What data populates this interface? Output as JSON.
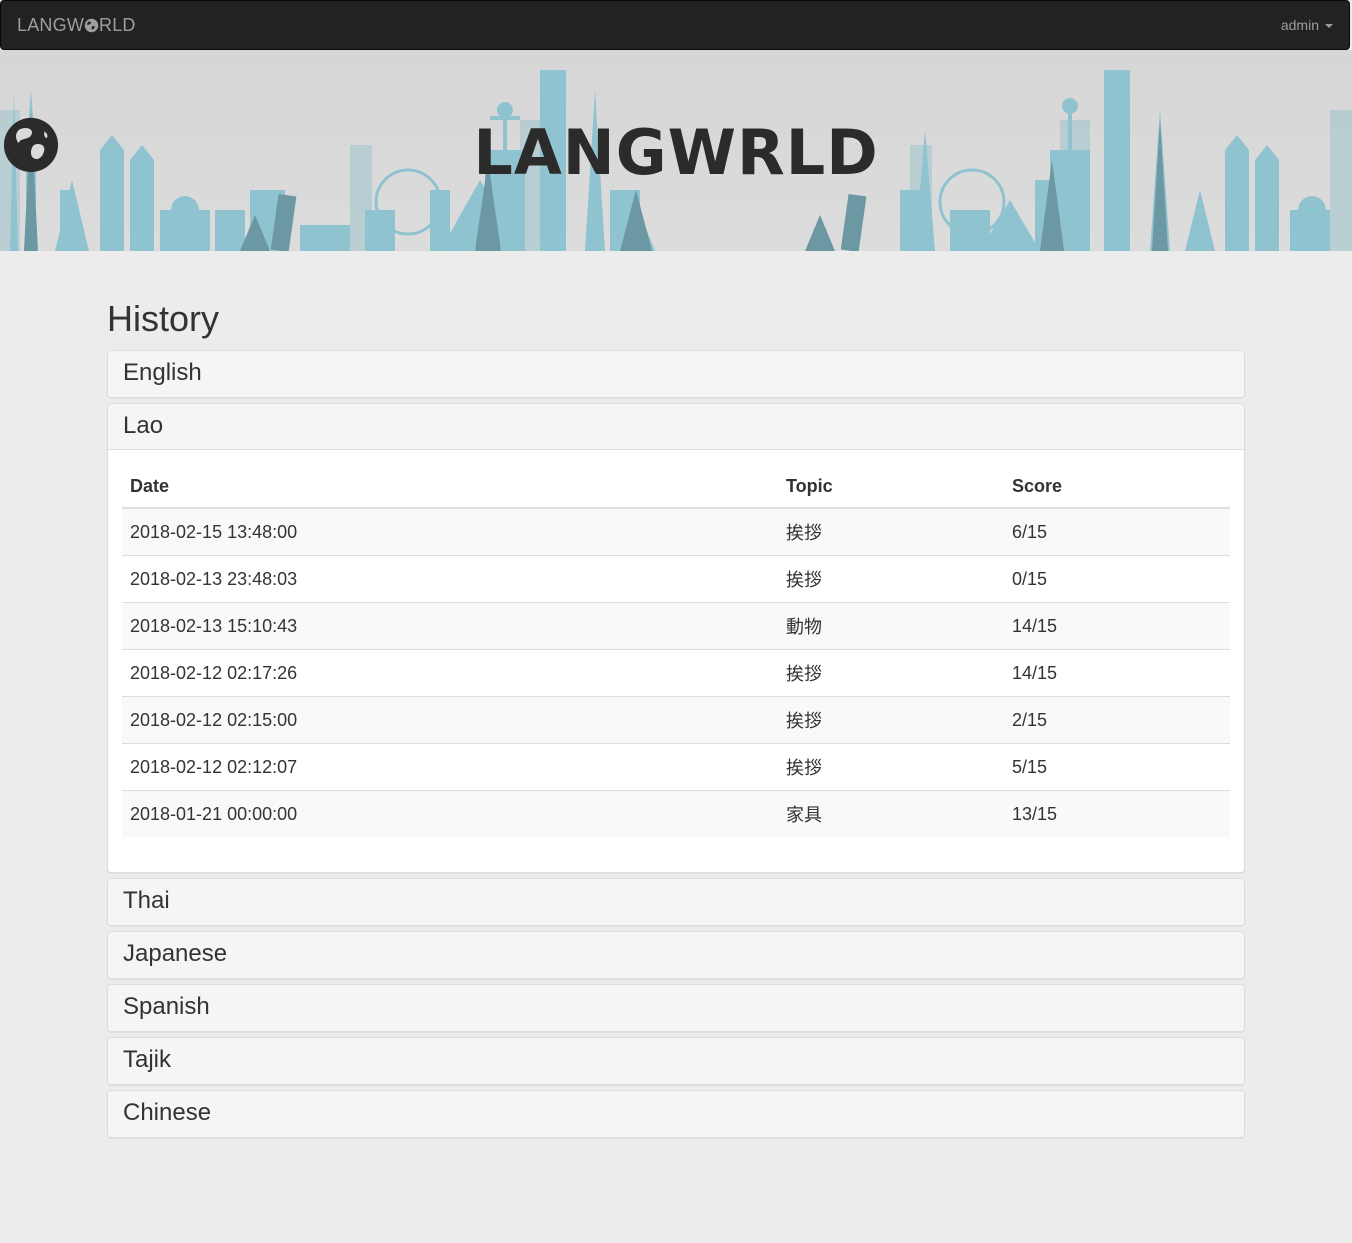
{
  "navbar": {
    "brand_pre": "LANGW",
    "brand_post": "RLD",
    "user": "admin"
  },
  "banner": {
    "title_pre": "LANGW",
    "title_post": "RLD"
  },
  "page": {
    "title": "History"
  },
  "history": {
    "columns": [
      "Date",
      "Topic",
      "Score"
    ],
    "languages": [
      {
        "name": "English",
        "open": false
      },
      {
        "name": "Lao",
        "open": true
      },
      {
        "name": "Thai",
        "open": false
      },
      {
        "name": "Japanese",
        "open": false
      },
      {
        "name": "Spanish",
        "open": false
      },
      {
        "name": "Tajik",
        "open": false
      },
      {
        "name": "Chinese",
        "open": false
      }
    ],
    "lao_rows": [
      {
        "date": "2018-02-15 13:48:00",
        "topic": "挨拶",
        "score": "6/15"
      },
      {
        "date": "2018-02-13 23:48:03",
        "topic": "挨拶",
        "score": "0/15"
      },
      {
        "date": "2018-02-13 15:10:43",
        "topic": "動物",
        "score": "14/15"
      },
      {
        "date": "2018-02-12 02:17:26",
        "topic": "挨拶",
        "score": "14/15"
      },
      {
        "date": "2018-02-12 02:15:00",
        "topic": "挨拶",
        "score": "2/15"
      },
      {
        "date": "2018-02-12 02:12:07",
        "topic": "挨拶",
        "score": "5/15"
      },
      {
        "date": "2018-01-21 00:00:00",
        "topic": "家具",
        "score": "13/15"
      }
    ]
  },
  "colors": {
    "navbar_bg": "#222222",
    "skyline_light": "#8fc3cf",
    "skyline_dark": "#6b98a3"
  }
}
